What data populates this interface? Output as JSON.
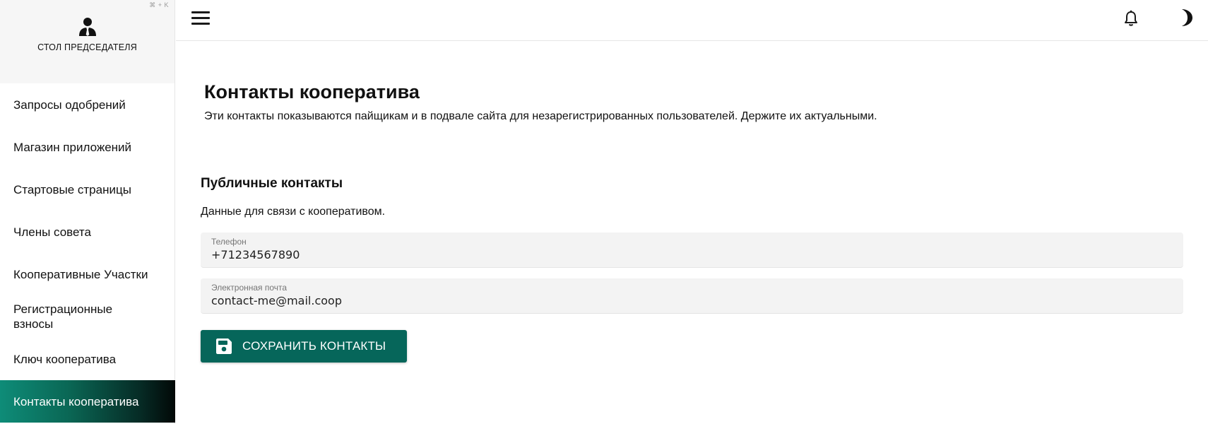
{
  "sidebar": {
    "shortcut": "⌘ + K",
    "title": "СТОЛ ПРЕДСЕДАТЕЛЯ",
    "items": [
      {
        "label": "Запросы одобрений"
      },
      {
        "label": "Магазин приложений"
      },
      {
        "label": "Стартовые страницы"
      },
      {
        "label": "Члены совета"
      },
      {
        "label": "Кооперативные Участки"
      },
      {
        "label": "Регистрационные взносы"
      },
      {
        "label": "Ключ кооператива"
      },
      {
        "label": "Контакты кооператива",
        "active": true
      }
    ]
  },
  "header": {
    "menu_icon": "hamburger-menu-icon",
    "notifications_icon": "bell-icon",
    "theme_icon": "moon-icon"
  },
  "main": {
    "title": "Контакты кооператива",
    "description": "Эти контакты показываются пайщикам и в подвале сайта для незарегистрированных пользователей. Держите их актуальными.",
    "section": {
      "title": "Публичные контакты",
      "description": "Данные для связи с кооперативом.",
      "phone": {
        "label": "Телефон",
        "value": "+71234567890"
      },
      "email": {
        "label": "Электронная почта",
        "value": "contact-me@mail.coop"
      },
      "save_label": "СОХРАНИТЬ КОНТАКТЫ"
    }
  },
  "colors": {
    "accent": "#06665a",
    "active_gradient_start": "#0e8c78",
    "active_gradient_end": "#020807"
  }
}
